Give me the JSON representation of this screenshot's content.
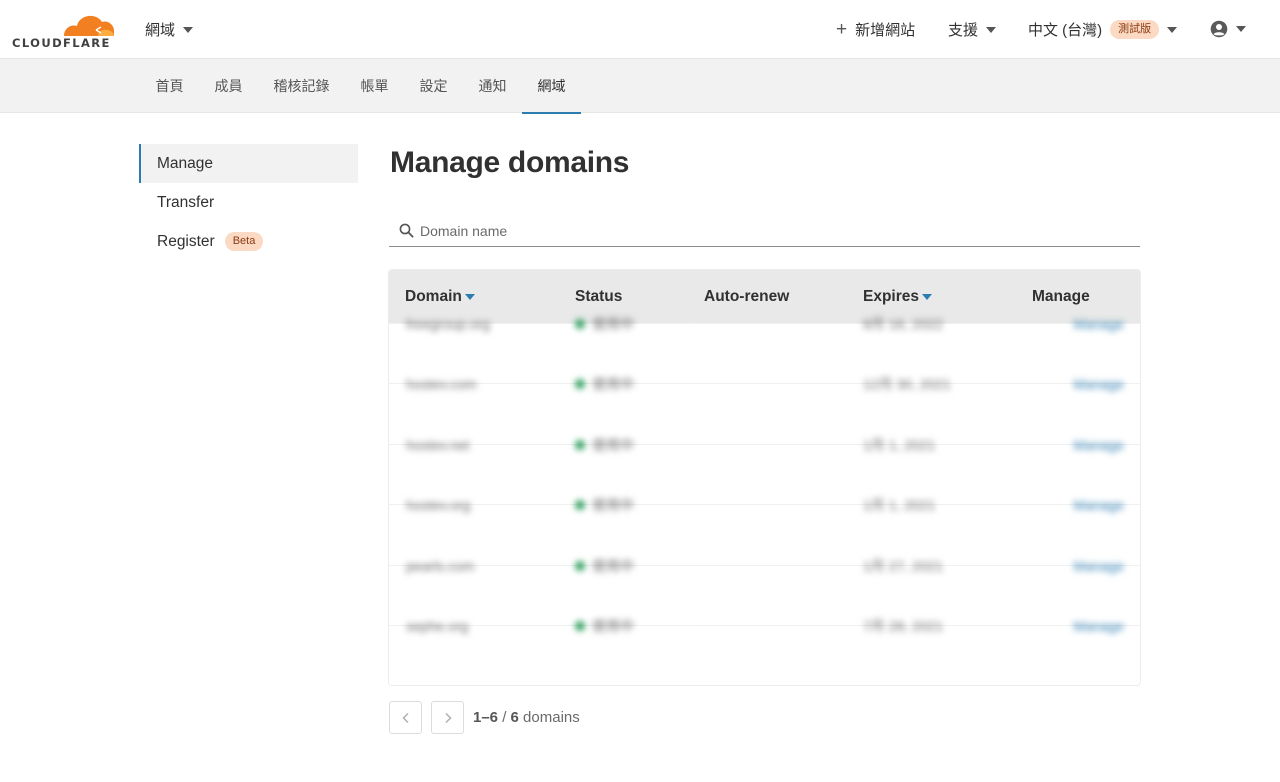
{
  "header": {
    "logo_text": "CLOUDFLARE",
    "account_label": "網域",
    "add_site_label": "新增網站",
    "support_label": "支援",
    "language_label": "中文 (台灣)",
    "language_badge": "測試版"
  },
  "subnav": {
    "tabs": [
      {
        "label": "首頁"
      },
      {
        "label": "成員"
      },
      {
        "label": "稽核記錄"
      },
      {
        "label": "帳單"
      },
      {
        "label": "設定"
      },
      {
        "label": "通知"
      },
      {
        "label": "網域",
        "active": true
      }
    ]
  },
  "sidebar": {
    "items": [
      {
        "label": "Manage",
        "active": true
      },
      {
        "label": "Transfer"
      },
      {
        "label": "Register",
        "badge": "Beta"
      }
    ]
  },
  "main": {
    "title": "Manage domains",
    "search_placeholder": "Domain name",
    "table": {
      "headers": {
        "domain": "Domain",
        "status": "Status",
        "auto_renew": "Auto-renew",
        "expires": "Expires",
        "manage": "Manage"
      },
      "rows": [
        {
          "domain": "freegroup.org",
          "status": "使用中",
          "auto_renew": true,
          "expires": "8月 16, 2022",
          "manage": "Manage"
        },
        {
          "domain": "hostev.com",
          "status": "使用中",
          "auto_renew": true,
          "expires": "12月 30, 2021",
          "manage": "Manage"
        },
        {
          "domain": "hostev.net",
          "status": "使用中",
          "auto_renew": true,
          "expires": "1月 1, 2021",
          "manage": "Manage"
        },
        {
          "domain": "hostev.org",
          "status": "使用中",
          "auto_renew": true,
          "expires": "1月 1, 2021",
          "manage": "Manage"
        },
        {
          "domain": "pearls.com",
          "status": "使用中",
          "auto_renew": true,
          "expires": "1月 27, 2021",
          "manage": "Manage"
        },
        {
          "domain": "sephe.org",
          "status": "使用中",
          "auto_renew": true,
          "expires": "7月 28, 2021",
          "manage": "Manage"
        }
      ]
    },
    "pagination": {
      "range": "1–6",
      "separator": " / ",
      "total": "6",
      "unit": " domains"
    }
  },
  "colors": {
    "accent": "#2c7cb0",
    "brand_orange": "#f38020",
    "status_green": "#2f9e5e",
    "toggle_on": "#4bae73",
    "badge_bg": "#fbd9c2"
  },
  "icons": {
    "logo": "cloudflare-cloud-icon",
    "add": "plus-icon",
    "user": "user-circle-icon",
    "search": "search-icon",
    "prev": "chevron-left-icon",
    "next": "chevron-right-icon"
  }
}
